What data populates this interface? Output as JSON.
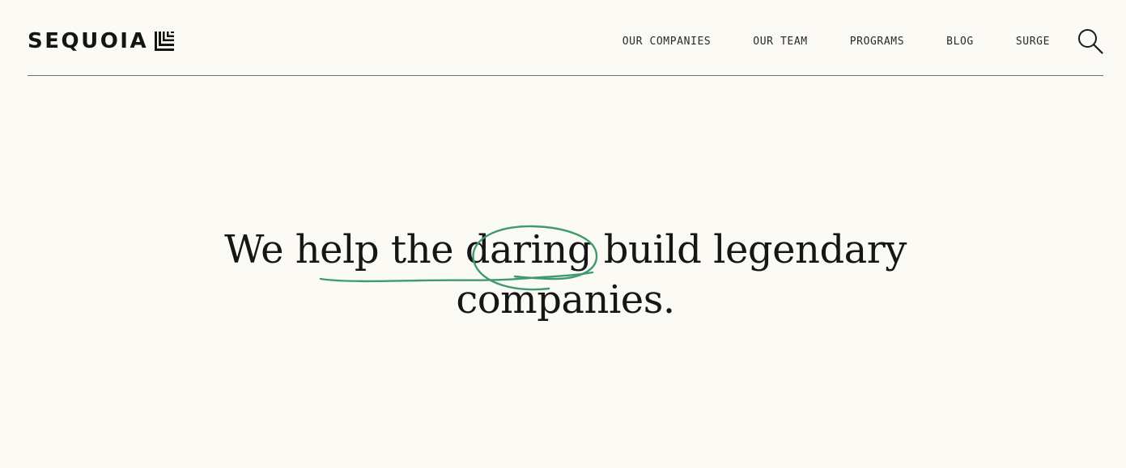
{
  "brand": {
    "name": "SEQUOIA"
  },
  "nav": {
    "items": [
      {
        "label": "OUR COMPANIES"
      },
      {
        "label": "OUR TEAM"
      },
      {
        "label": "PROGRAMS"
      },
      {
        "label": "BLOG"
      },
      {
        "label": "SURGE"
      }
    ],
    "search_icon": "search-icon"
  },
  "hero": {
    "line1": "We help the daring build legendary",
    "line2": "companies."
  },
  "colors": {
    "background": "#fcfaf5",
    "text": "#161616",
    "accent_scribble": "#3f9b6e",
    "divider": "#6b6b6b"
  }
}
